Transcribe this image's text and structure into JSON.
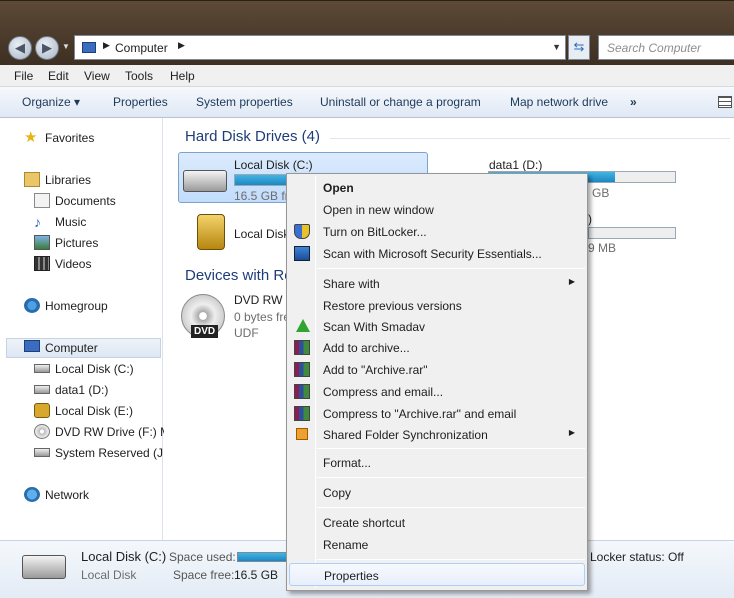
{
  "address_bar": {
    "back_glyph": "◀",
    "forward_glyph": "▶",
    "crumb": "Computer",
    "search_placeholder": "Search Computer"
  },
  "menubar": [
    "File",
    "Edit",
    "View",
    "Tools",
    "Help"
  ],
  "command_bar": {
    "organize": "Organize ▾",
    "properties": "Properties",
    "system_properties": "System properties",
    "uninstall": "Uninstall or change a program",
    "map_drive": "Map network drive",
    "more": "»"
  },
  "nav": {
    "favorites": "Favorites",
    "libraries": "Libraries",
    "documents": "Documents",
    "music": "Music",
    "pictures": "Pictures",
    "videos": "Videos",
    "homegroup": "Homegroup",
    "computer": "Computer",
    "local_c": "Local Disk (C:)",
    "data1_d": "data1 (D:)",
    "local_e": "Local Disk (E:)",
    "dvd_f": "DVD RW Drive (F:) M",
    "sys_reserved": "System Reserved (J:)",
    "network": "Network"
  },
  "content": {
    "hdd_header": "Hard Disk Drives (4)",
    "devices_header": "Devices with Re",
    "drive_c": {
      "name": "Local Disk (C:)",
      "sub": "16.5 GB fre",
      "used_fraction": 0.93
    },
    "drive_d": {
      "name": "data1 (D:)",
      "sub": "GB",
      "used_fraction": 0.68
    },
    "drive_e": {
      "name": "Local Disk",
      "sub": "",
      "used_fraction": 0.0
    },
    "drive_j": {
      "name": ")",
      "sub": "9 MB",
      "used_fraction": 0.0
    },
    "dvd": {
      "name": "DVD RW D",
      "sub": "0 bytes fre",
      "fs": "UDF",
      "label": "DVD"
    }
  },
  "context_menu": {
    "open": "Open",
    "open_new_window": "Open in new window",
    "bitlocker": "Turn on BitLocker...",
    "mse_scan": "Scan with Microsoft Security Essentials...",
    "share_with": "Share with",
    "restore_prev": "Restore previous versions",
    "smadav": "Scan With Smadav",
    "add_archive": "Add to archive...",
    "add_rar": "Add to \"Archive.rar\"",
    "compress_email": "Compress and email...",
    "compress_rar_email": "Compress to \"Archive.rar\" and email",
    "shared_sync": "Shared Folder Synchronization",
    "format": "Format...",
    "copy": "Copy",
    "create_shortcut": "Create shortcut",
    "rename": "Rename",
    "properties": "Properties",
    "submenu_arrow": "▶"
  },
  "details": {
    "name": "Local Disk (C:)",
    "type": "Local Disk",
    "space_used_label": "Space used:",
    "space_free_label": "Space free:",
    "space_free_value": "16.5 GB",
    "bitlocker": "Locker status:  Off"
  }
}
